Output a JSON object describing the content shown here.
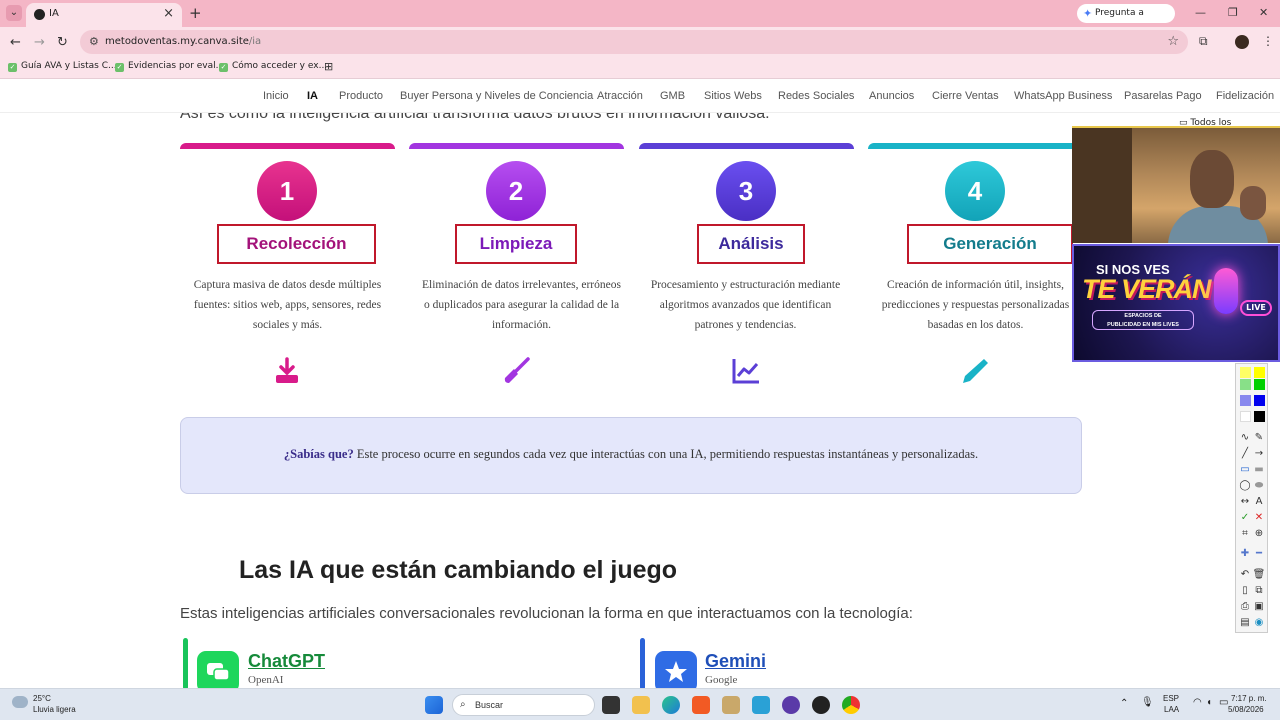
{
  "browser": {
    "tab_title": "IA",
    "gemini_label": "Pregunta a Gemini",
    "url_host": "metodoventas.my.canva.site",
    "url_path": "/ia",
    "bookmarks": [
      "Guía AVA y Listas C...",
      "Evidencias por eval...",
      "Cómo acceder y ex..."
    ],
    "all_bookmarks_label": "Todos los marcadores"
  },
  "site_nav": {
    "items": [
      "Inicio",
      "IA",
      "Producto",
      "Buyer Persona y Niveles de Conciencia",
      "Atracción",
      "GMB",
      "Sitios Webs",
      "Redes Sociales",
      "Anuncios",
      "Cierre Ventas",
      "WhatsApp Business",
      "Pasarelas Pago",
      "Fidelización"
    ],
    "active": "IA"
  },
  "process": {
    "heading_cut": "Así es cómo la inteligencia artificial transforma datos brutos en información valiosa.",
    "steps": [
      {
        "number": "1",
        "title": "Recolección",
        "desc": "Captura masiva de datos desde múltiples fuentes: sitios web, apps, sensores, redes sociales y más.",
        "icon": "download-icon",
        "color": "#d81b8a"
      },
      {
        "number": "2",
        "title": "Limpieza",
        "desc": "Eliminación de datos irrelevantes, erróneos o duplicados para asegurar la calidad de la información.",
        "icon": "broom-icon",
        "color": "#a235e0"
      },
      {
        "number": "3",
        "title": "Análisis",
        "desc": "Procesamiento y estructuración mediante algoritmos avanzados que identifican patrones y tendencias.",
        "icon": "chart-line-icon",
        "color": "#5b3fd6"
      },
      {
        "number": "4",
        "title": "Generación",
        "desc": "Creación de información útil, insights, predicciones y respuestas personalizadas basadas en los datos.",
        "icon": "pen-icon",
        "color": "#19b3c7"
      }
    ]
  },
  "tip": {
    "bold": "¿Sabías que?",
    "text": " Este proceso ocurre en segundos cada vez que interactúas con una IA, permitiendo respuestas instantáneas y personalizadas."
  },
  "ai_section": {
    "title": "Las IA que están cambiando el juego",
    "lead": "Estas inteligencias artificiales conversacionales revolucionan la forma en que interactuamos con la tecnología:",
    "cards": [
      {
        "name": "ChatGPT",
        "company": "OpenAI",
        "color": "#19b04a",
        "icon": "chat-bubbles-icon"
      },
      {
        "name": "Gemini",
        "company": "Google",
        "color": "#2a62d8",
        "icon": "star-icon"
      }
    ]
  },
  "promo": {
    "line1": "SI NOS VES",
    "line2": "TE VERÁN",
    "line3a": "ESPACIOS DE",
    "line3b": "PUBLICIDAD EN MIS LIVES",
    "live": "LIVE"
  },
  "taskbar": {
    "temp": "25°C",
    "weather": "Lluvia ligera",
    "search_placeholder": "Buscar",
    "lang1": "ESP",
    "lang2": "LAA",
    "time": "7:17 p. m.",
    "date": "5/08/2026"
  }
}
